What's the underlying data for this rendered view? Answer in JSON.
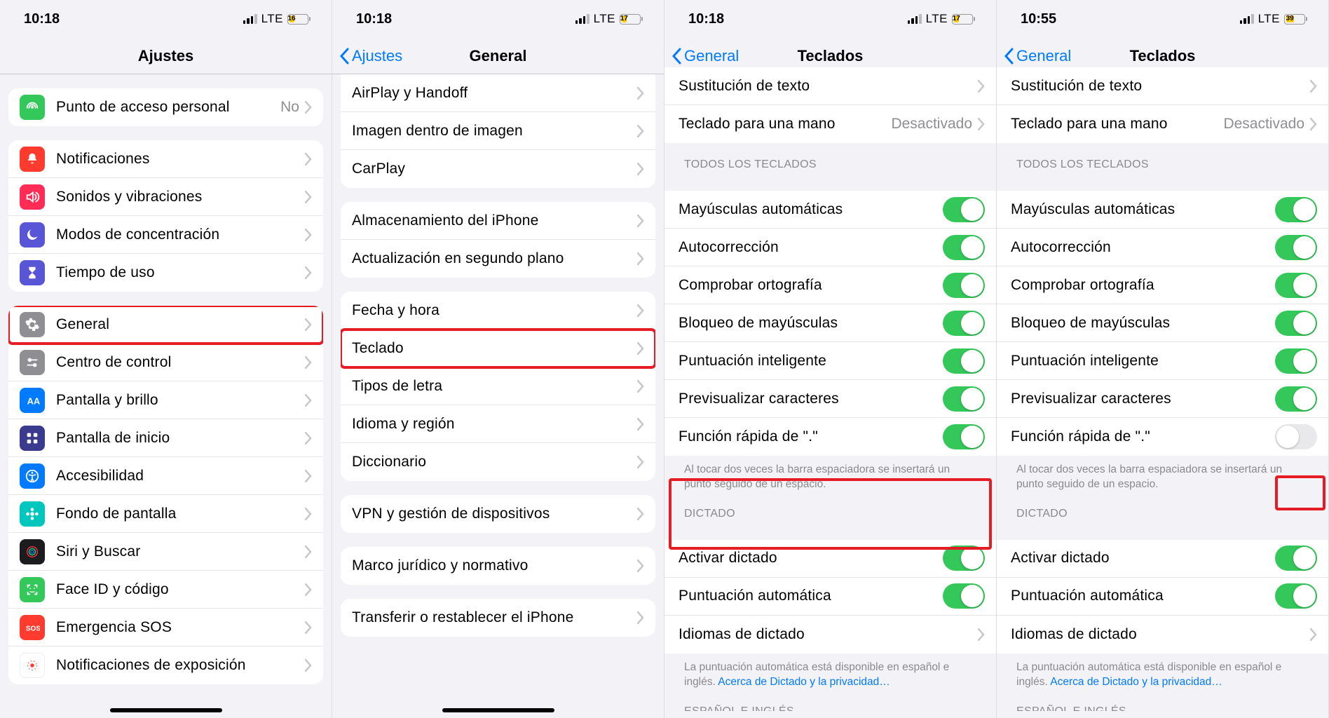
{
  "screen1": {
    "status": {
      "time": "10:18",
      "lte": "LTE",
      "batt_pct": "16",
      "batt_width": "16%"
    },
    "title": "Ajustes",
    "hotspot": {
      "label": "Punto de acceso personal",
      "value": "No"
    },
    "g2": {
      "notif": "Notificaciones",
      "sound": "Sonidos y vibraciones",
      "focus": "Modos de concentración",
      "screen_time": "Tiempo de uso"
    },
    "g3": {
      "general": "General",
      "control": "Centro de control",
      "display": "Pantalla y brillo",
      "home": "Pantalla de inicio",
      "access": "Accesibilidad",
      "wallpaper": "Fondo de pantalla",
      "siri": "Siri y Buscar",
      "faceid": "Face ID y código",
      "sos": "Emergencia SOS",
      "exposure": "Notificaciones de exposición"
    }
  },
  "screen2": {
    "status": {
      "time": "10:18",
      "lte": "LTE",
      "batt_pct": "17",
      "batt_width": "17%"
    },
    "back": "Ajustes",
    "title": "General",
    "g1": {
      "airplay": "AirPlay y Handoff",
      "pip": "Imagen dentro de imagen",
      "carplay": "CarPlay"
    },
    "g2": {
      "storage": "Almacenamiento del iPhone",
      "bg": "Actualización en segundo plano"
    },
    "g3": {
      "date": "Fecha y hora",
      "keyboard": "Teclado",
      "font": "Tipos de letra",
      "lang": "Idioma y región",
      "dict": "Diccionario"
    },
    "g4": {
      "vpn": "VPN y gestión de dispositivos"
    },
    "g5": {
      "legal": "Marco jurídico y normativo"
    },
    "g6": {
      "transfer": "Transferir o restablecer el iPhone"
    }
  },
  "screen3": {
    "status": {
      "time": "10:18",
      "lte": "LTE",
      "batt_pct": "17",
      "batt_width": "17%"
    },
    "back": "General",
    "title": "Teclados",
    "g1": {
      "subst": "Sustitución de texto",
      "onehand": "Teclado para una mano",
      "onehand_val": "Desactivado"
    },
    "sec1_header": "TODOS LOS TECLADOS",
    "toggles": {
      "autocap": "Mayúsculas automáticas",
      "autocorrect": "Autocorrección",
      "spell": "Comprobar ortografía",
      "capslock": "Bloqueo de mayúsculas",
      "smart": "Puntuación inteligente",
      "preview": "Previsualizar caracteres",
      "period": "Función rápida de \".\""
    },
    "period_footer": "Al tocar dos veces la barra espaciadora se insertará un punto seguido de un espacio.",
    "sec2_header": "DICTADO",
    "dict": {
      "enable": "Activar dictado",
      "autopunct": "Puntuación automática",
      "langs": "Idiomas de dictado"
    },
    "dict_footer_a": "La puntuación automática está disponible en español e inglés. ",
    "dict_footer_link": "Acerca de Dictado y la privacidad…",
    "sec3_header": "ESPAÑOL E INGLÉS"
  },
  "screen4": {
    "status": {
      "time": "10:55",
      "lte": "LTE",
      "batt_pct": "39",
      "batt_width": "39%"
    }
  }
}
